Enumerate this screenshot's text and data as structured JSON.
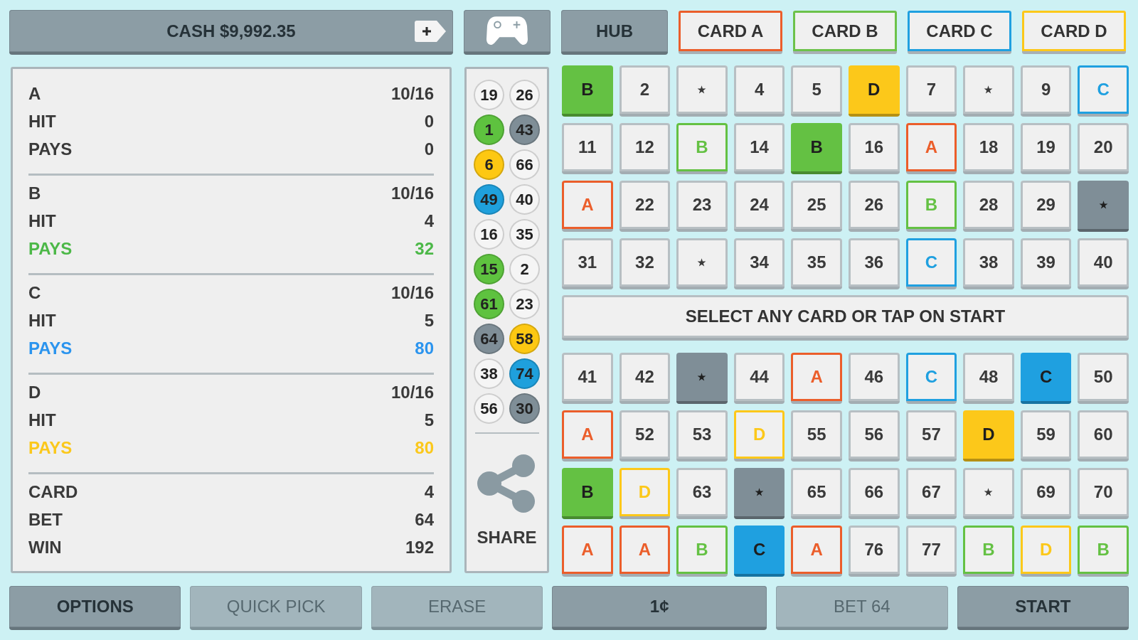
{
  "top_bar": {
    "cash_button": {
      "label": "CASH $9,992.35"
    },
    "hub_button": {
      "label": "HUB"
    },
    "card_tabs": [
      {
        "label": "CARD A",
        "color": "#eb5e2b"
      },
      {
        "label": "CARD B",
        "color": "#6cc24a"
      },
      {
        "label": "CARD C",
        "color": "#1fa0e0"
      },
      {
        "label": "CARD D",
        "color": "#fcc81a"
      }
    ]
  },
  "summary": {
    "sections": [
      {
        "rows": [
          {
            "label": "A",
            "value": "10/16"
          },
          {
            "label": "HIT",
            "value": "0"
          },
          {
            "label": "PAYS",
            "value": "0"
          }
        ]
      },
      {
        "rows": [
          {
            "label": "B",
            "value": "10/16"
          },
          {
            "label": "HIT",
            "value": "4"
          },
          {
            "label": "PAYS",
            "value": "32",
            "color": "#4cb848"
          }
        ]
      },
      {
        "rows": [
          {
            "label": "C",
            "value": "10/16"
          },
          {
            "label": "HIT",
            "value": "5"
          },
          {
            "label": "PAYS",
            "value": "80",
            "color": "#2b94ee"
          }
        ]
      },
      {
        "rows": [
          {
            "label": "D",
            "value": "10/16"
          },
          {
            "label": "HIT",
            "value": "5"
          },
          {
            "label": "PAYS",
            "value": "80",
            "color": "#fbc81c"
          }
        ]
      },
      {
        "rows": [
          {
            "label": "CARD",
            "value": "4"
          },
          {
            "label": "BET",
            "value": "64"
          },
          {
            "label": "WIN",
            "value": "192"
          }
        ]
      }
    ]
  },
  "drawn_balls": [
    {
      "label": "19",
      "color": "#f5f5f5"
    },
    {
      "label": "26",
      "color": "#f5f5f5"
    },
    {
      "label": "1",
      "color": "#5ec23f"
    },
    {
      "label": "43",
      "color": "#7f8e97"
    },
    {
      "label": "6",
      "color": "#fdc812"
    },
    {
      "label": "66",
      "color": "#f5f5f5"
    },
    {
      "label": "49",
      "color": "#1fa0dc"
    },
    {
      "label": "40",
      "color": "#f5f5f5"
    },
    {
      "label": "16",
      "color": "#f5f5f5"
    },
    {
      "label": "35",
      "color": "#f5f5f5"
    },
    {
      "label": "15",
      "color": "#5ec23f"
    },
    {
      "label": "2",
      "color": "#f5f5f5"
    },
    {
      "label": "61",
      "color": "#5ec23f"
    },
    {
      "label": "23",
      "color": "#f5f5f5"
    },
    {
      "label": "64",
      "color": "#7f8e97"
    },
    {
      "label": "58",
      "color": "#fdc812"
    },
    {
      "label": "38",
      "color": "#f5f5f5"
    },
    {
      "label": "74",
      "color": "#1fa0dc"
    },
    {
      "label": "56",
      "color": "#f5f5f5"
    },
    {
      "label": "30",
      "color": "#7f8e97"
    }
  ],
  "share_button": {
    "label": "SHARE"
  },
  "board": {
    "upper_cells": [
      {
        "label": "B",
        "color": "#64c143",
        "filled": true
      },
      {
        "label": "2",
        "filled": false
      },
      {
        "label": "⋆",
        "filled": false
      },
      {
        "label": "4",
        "filled": false
      },
      {
        "label": "5",
        "filled": false
      },
      {
        "label": "D",
        "color": "#fcc81a",
        "filled": true
      },
      {
        "label": "7",
        "filled": false
      },
      {
        "label": "⋆",
        "filled": false
      },
      {
        "label": "9",
        "filled": false
      },
      {
        "label": "C",
        "color": "#1fa0e0",
        "filled": false
      },
      {
        "label": "11",
        "filled": false
      },
      {
        "label": "12",
        "filled": false
      },
      {
        "label": "B",
        "color": "#64c143",
        "filled": false
      },
      {
        "label": "14",
        "filled": false
      },
      {
        "label": "B",
        "color": "#64c143",
        "filled": true
      },
      {
        "label": "16",
        "filled": false
      },
      {
        "label": "A",
        "color": "#eb5e2b",
        "filled": false
      },
      {
        "label": "18",
        "filled": false
      },
      {
        "label": "19",
        "filled": false
      },
      {
        "label": "20",
        "filled": false
      },
      {
        "label": "A",
        "color": "#eb5e2b",
        "filled": false
      },
      {
        "label": "22",
        "filled": false
      },
      {
        "label": "23",
        "filled": false
      },
      {
        "label": "24",
        "filled": false
      },
      {
        "label": "25",
        "filled": false
      },
      {
        "label": "26",
        "filled": false
      },
      {
        "label": "B",
        "color": "#64c143",
        "filled": false
      },
      {
        "label": "28",
        "filled": false
      },
      {
        "label": "29",
        "filled": false
      },
      {
        "label": "⋆",
        "color": "#7f8e97",
        "filled": true
      },
      {
        "label": "31",
        "filled": false
      },
      {
        "label": "32",
        "filled": false
      },
      {
        "label": "⋆",
        "filled": false
      },
      {
        "label": "34",
        "filled": false
      },
      {
        "label": "35",
        "filled": false
      },
      {
        "label": "36",
        "filled": false
      },
      {
        "label": "C",
        "color": "#1fa0e0",
        "filled": false
      },
      {
        "label": "38",
        "filled": false
      },
      {
        "label": "39",
        "filled": false
      },
      {
        "label": "40",
        "filled": false
      }
    ],
    "message": "SELECT ANY CARD OR TAP ON START",
    "lower_cells": [
      {
        "label": "41",
        "filled": false
      },
      {
        "label": "42",
        "filled": false
      },
      {
        "label": "⋆",
        "color": "#7f8e97",
        "filled": true
      },
      {
        "label": "44",
        "filled": false
      },
      {
        "label": "A",
        "color": "#eb5e2b",
        "filled": false
      },
      {
        "label": "46",
        "filled": false
      },
      {
        "label": "C",
        "color": "#1fa0e0",
        "filled": false
      },
      {
        "label": "48",
        "filled": false
      },
      {
        "label": "C",
        "color": "#1fa0e0",
        "filled": true
      },
      {
        "label": "50",
        "filled": false
      },
      {
        "label": "A",
        "color": "#eb5e2b",
        "filled": false
      },
      {
        "label": "52",
        "filled": false
      },
      {
        "label": "53",
        "filled": false
      },
      {
        "label": "D",
        "color": "#fcc81a",
        "filled": false
      },
      {
        "label": "55",
        "filled": false
      },
      {
        "label": "56",
        "filled": false
      },
      {
        "label": "57",
        "filled": false
      },
      {
        "label": "D",
        "color": "#fcc81a",
        "filled": true
      },
      {
        "label": "59",
        "filled": false
      },
      {
        "label": "60",
        "filled": false
      },
      {
        "label": "B",
        "color": "#64c143",
        "filled": true
      },
      {
        "label": "D",
        "color": "#fcc81a",
        "filled": false
      },
      {
        "label": "63",
        "filled": false
      },
      {
        "label": "⋆",
        "color": "#7f8e97",
        "filled": true
      },
      {
        "label": "65",
        "filled": false
      },
      {
        "label": "66",
        "filled": false
      },
      {
        "label": "67",
        "filled": false
      },
      {
        "label": "⋆",
        "filled": false
      },
      {
        "label": "69",
        "filled": false
      },
      {
        "label": "70",
        "filled": false
      },
      {
        "label": "A",
        "color": "#eb5e2b",
        "filled": false
      },
      {
        "label": "A",
        "color": "#eb5e2b",
        "filled": false
      },
      {
        "label": "B",
        "color": "#64c143",
        "filled": false
      },
      {
        "label": "C",
        "color": "#1fa0e0",
        "filled": true
      },
      {
        "label": "A",
        "color": "#eb5e2b",
        "filled": false
      },
      {
        "label": "76",
        "filled": false
      },
      {
        "label": "77",
        "filled": false
      },
      {
        "label": "B",
        "color": "#64c143",
        "filled": false
      },
      {
        "label": "D",
        "color": "#fcc81a",
        "filled": false
      },
      {
        "label": "B",
        "color": "#64c143",
        "filled": false
      }
    ]
  },
  "bottom_bar": {
    "buttons": [
      {
        "label": "OPTIONS",
        "disabled": false
      },
      {
        "label": "QUICK PICK",
        "disabled": true
      },
      {
        "label": "ERASE",
        "disabled": true
      },
      {
        "label": "1¢",
        "disabled": false
      },
      {
        "label": "BET 64",
        "disabled": true
      },
      {
        "label": "START",
        "disabled": false
      }
    ]
  }
}
